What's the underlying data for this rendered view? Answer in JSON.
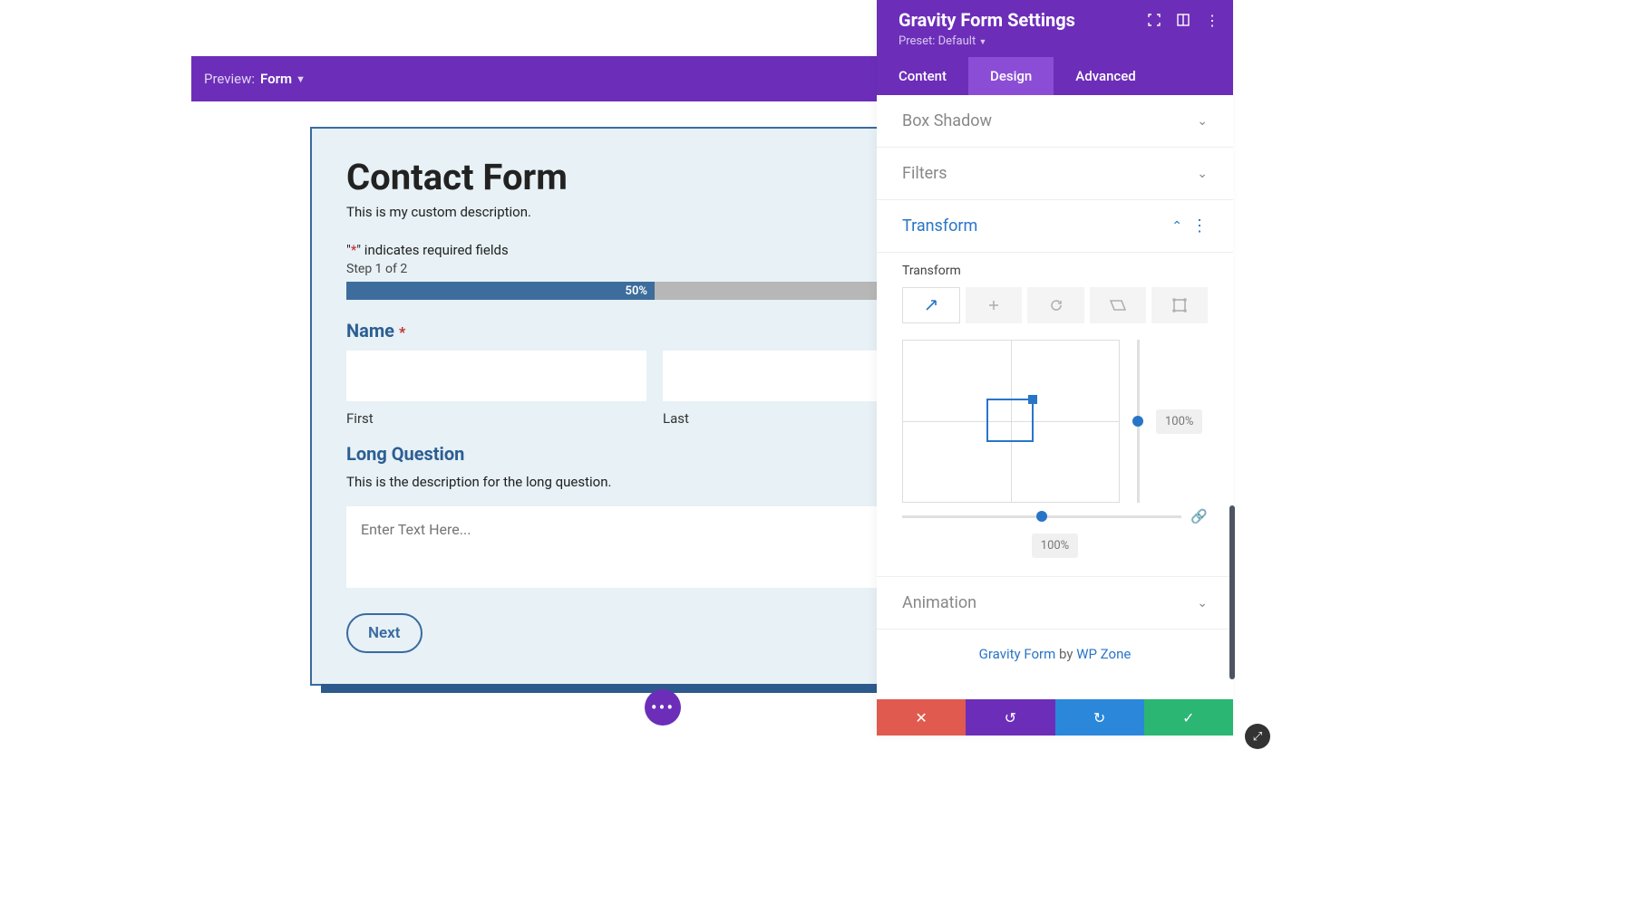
{
  "preview": {
    "label": "Preview:",
    "mode": "Form"
  },
  "form": {
    "title": "Contact Form",
    "description": "This is my custom description.",
    "required_note_prefix": "\"",
    "required_star": "*",
    "required_note_suffix": "\" indicates required fields",
    "step": "Step 1 of 2",
    "progress": "50%",
    "name_label": "Name",
    "first_sub": "First",
    "last_sub": "Last",
    "long_q_label": "Long Question",
    "long_q_desc": "This is the description for the long question.",
    "textarea_placeholder": "Enter Text Here...",
    "next": "Next"
  },
  "panel": {
    "title": "Gravity Form Settings",
    "preset": "Preset: Default",
    "tabs": {
      "content": "Content",
      "design": "Design",
      "advanced": "Advanced"
    },
    "sections": {
      "box_shadow": "Box Shadow",
      "filters": "Filters",
      "transform": "Transform",
      "animation": "Animation"
    },
    "transform": {
      "sublabel": "Transform",
      "vpct": "100%",
      "hpct": "100%"
    },
    "footer": {
      "brand": "Gravity Form",
      "by": " by ",
      "author": "WP Zone"
    }
  }
}
